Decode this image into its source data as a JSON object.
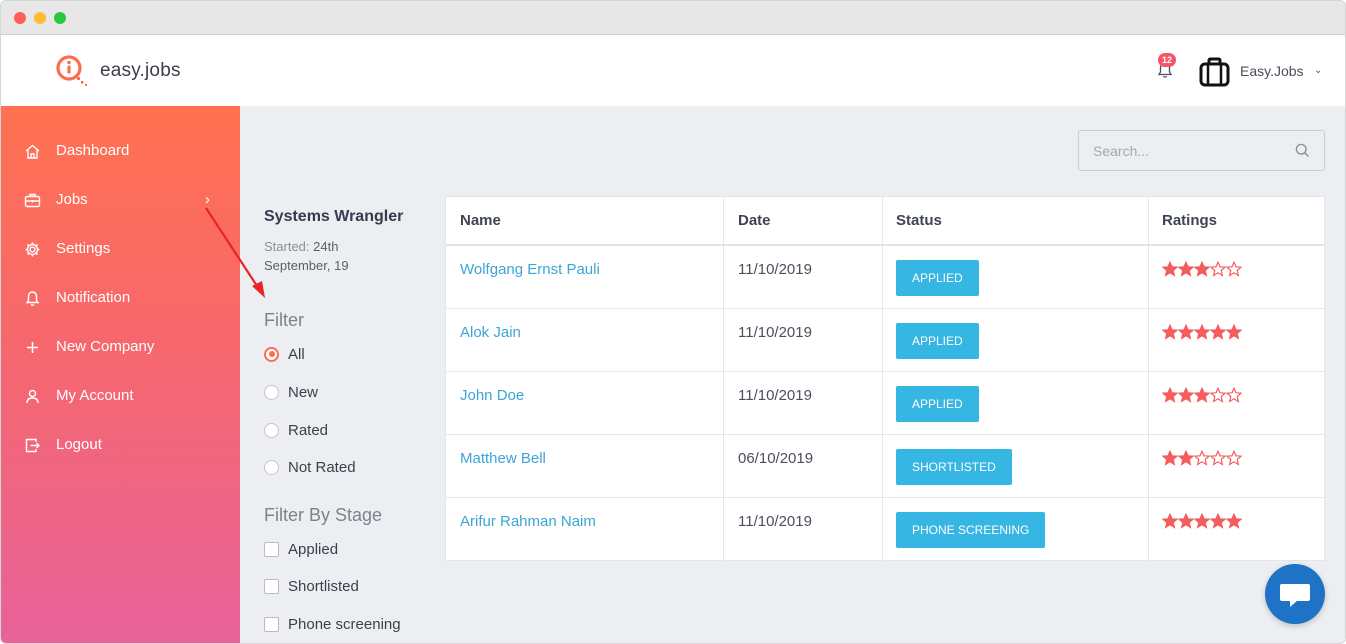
{
  "app": {
    "name": "easy.jobs",
    "notification_count": "12",
    "company_name": "Easy.Jobs"
  },
  "sidebar": {
    "items": [
      {
        "label": "Dashboard",
        "icon": "home-icon"
      },
      {
        "label": "Jobs",
        "icon": "briefcase-icon"
      },
      {
        "label": "Settings",
        "icon": "gear-icon"
      },
      {
        "label": "Notification",
        "icon": "bell-icon"
      },
      {
        "label": "New Company",
        "icon": "plus-icon"
      },
      {
        "label": "My Account",
        "icon": "user-icon"
      },
      {
        "label": "Logout",
        "icon": "logout-icon"
      }
    ]
  },
  "search": {
    "placeholder": "Search..."
  },
  "job": {
    "title": "Systems Wrangler",
    "started_label": "Started:",
    "started_date_1": "24th",
    "started_date_2": "September, 19"
  },
  "filter": {
    "title": "Filter",
    "options": [
      "All",
      "New",
      "Rated",
      "Not Rated"
    ],
    "selected": "All"
  },
  "stage_filter": {
    "title": "Filter By Stage",
    "options": [
      "Applied",
      "Shortlisted",
      "Phone screening"
    ]
  },
  "table": {
    "headers": [
      "Name",
      "Date",
      "Status",
      "Ratings"
    ],
    "rows": [
      {
        "name": "Wolfgang Ernst Pauli",
        "date": "11/10/2019",
        "status": "APPLIED",
        "rating": 3
      },
      {
        "name": "Alok Jain",
        "date": "11/10/2019",
        "status": "APPLIED",
        "rating": 5
      },
      {
        "name": "John Doe",
        "date": "11/10/2019",
        "status": "APPLIED",
        "rating": 3
      },
      {
        "name": "Matthew Bell",
        "date": "06/10/2019",
        "status": "SHORTLISTED",
        "rating": 2
      },
      {
        "name": "Arifur Rahman Naim",
        "date": "11/10/2019",
        "status": "PHONE SCREENING",
        "rating": 5
      }
    ],
    "max_rating": 5
  },
  "colors": {
    "accent": "#ff6b4e",
    "status": "#36b6e3",
    "link": "#3ba6d6",
    "star": "#f45d5d",
    "chat": "#1e73c6"
  }
}
